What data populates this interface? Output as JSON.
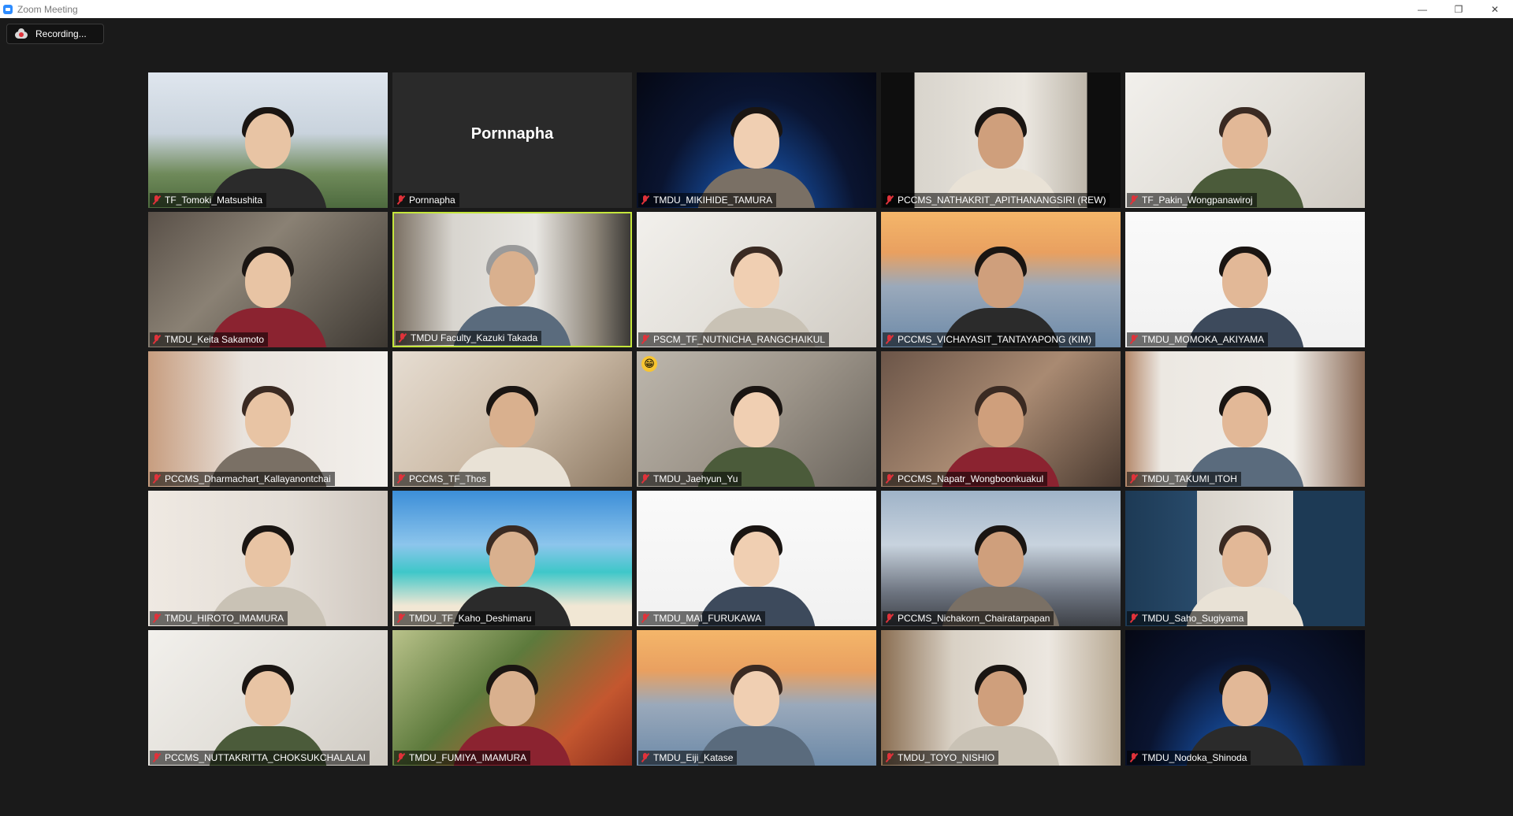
{
  "window": {
    "title": "Zoom Meeting",
    "minimize_icon": "minimize-icon",
    "restore_icon": "restore-icon",
    "close_icon": "close-icon"
  },
  "recording": {
    "label": "Recording..."
  },
  "participants": [
    {
      "name": "TF_Tomoki_Matsushita",
      "bg": "city"
    },
    {
      "name": "Pornnapha",
      "display": "Pornnapha",
      "video": false
    },
    {
      "name": "TMDU_MIKIHIDE_TAMURA",
      "bg": "earth"
    },
    {
      "name": "PCCMS_NATHAKRIT_APITHANANGSIRI (REW)",
      "bg": "room-dark"
    },
    {
      "name": "TF_Pakin_Wongpanawiroj",
      "bg": "room-light"
    },
    {
      "name": "TMDU_Keita Sakamoto",
      "bg": "room-blur"
    },
    {
      "name": "TMDU Faculty_Kazuki Takada",
      "bg": "office",
      "active": true
    },
    {
      "name": "PSCM_TF_NUTNICHA_RANGCHAIKUL",
      "bg": "room-light"
    },
    {
      "name": "PCCMS_VICHAYASIT_TANTAYAPONG (KIM)",
      "bg": "bridge"
    },
    {
      "name": "TMDU_MOMOKA_AKIYAMA",
      "bg": "white"
    },
    {
      "name": "PCCMS_Dharmachart_Kallayanontchai",
      "bg": "room-warm"
    },
    {
      "name": "PCCMS_TF_Thos",
      "bg": "room-blur-light"
    },
    {
      "name": "TMDU_Jaehyun_Yu",
      "bg": "room-grey",
      "reaction": "😁"
    },
    {
      "name": "PCCMS_Napatr_Wongboonkuakul",
      "bg": "room-brown"
    },
    {
      "name": "TMDU_TAKUMI_ITOH",
      "bg": "room-wood"
    },
    {
      "name": "TMDU_HIROTO_IMAMURA",
      "bg": "room-art"
    },
    {
      "name": "TMDU_TF_Kaho_Deshimaru",
      "bg": "beach"
    },
    {
      "name": "TMDU_MAI_FURUKAWA",
      "bg": "white"
    },
    {
      "name": "PCCMS_Nichakorn_Chairatarpapan",
      "bg": "sky"
    },
    {
      "name": "TMDU_Saho_Sugiyama",
      "bg": "poster"
    },
    {
      "name": "PCCMS_NUTTAKRITTA_CHOKSUKCHALALAI",
      "bg": "room-light"
    },
    {
      "name": "TMDU_FUMIYA_IMAMURA",
      "bg": "garden"
    },
    {
      "name": "TMDU_Eiji_Katase",
      "bg": "bridge"
    },
    {
      "name": "TMDU_TOYO_NISHIO",
      "bg": "room-tan"
    },
    {
      "name": "TMDU_Nodoka_Shinoda",
      "bg": "earth"
    }
  ]
}
